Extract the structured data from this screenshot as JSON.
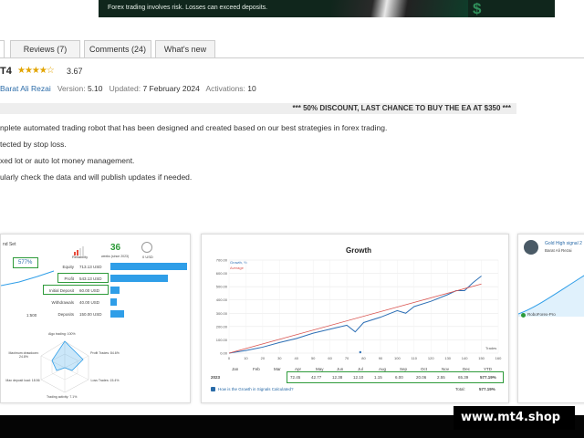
{
  "banner": {
    "text": "Forex trading involves risk. Losses can exceed deposits."
  },
  "tabs": [
    "Reviews (7)",
    "Comments (24)",
    "What's new"
  ],
  "product": {
    "title": "T4",
    "rating": "3.67",
    "rating_value": 3.67,
    "author": "Barat Ali Rezai",
    "version_label": "Version:",
    "version": "5.10",
    "updated_label": "Updated:",
    "updated": "7 February 2024",
    "activations_label": "Activations:",
    "activations": "10"
  },
  "discount": "*** 50% DISCOUNT, LAST CHANCE TO BUY THE EA AT $350 ***",
  "description": [
    "nplete automated trading robot that has been designed and created based on our best strategies in forex trading.",
    "tected by stop loss.",
    "xed lot or auto lot money management.",
    "ularly check the data and will publish updates if needed."
  ],
  "panel1": {
    "heading": "nd Set",
    "growth_badge": "577%",
    "weeks_value": "36",
    "weeks_label": "weeks (since 2023)",
    "reliability": "Reliability",
    "usd_label": "0 USD",
    "rows": [
      {
        "label": "Equity",
        "value": "713.13 USD",
        "fraction": 1.0
      },
      {
        "label": "Profit",
        "value": "543.13 USD",
        "fraction": 0.75
      },
      {
        "label": "Initial Deposit",
        "value": "60.00 USD",
        "fraction": 0.12
      },
      {
        "label": "Withdrawals",
        "value": "40.00 USD",
        "fraction": 0.08
      },
      {
        "label": "Deposits",
        "value": "150.00 USD",
        "fraction": 0.18
      }
    ],
    "leverage": "1:500",
    "radar": {
      "algo": "Algo trading: 100%",
      "max_dd": "Maximum drawdown: 24.8%",
      "profit_trades": "Profit Trades: 84.6%",
      "max_deposit_load": "Max deposit load: 18.56",
      "loss_trades": "Loss Trades: 15.4%",
      "activity": "Trading activity: 7.1%"
    }
  },
  "panel2": {
    "title": "Growth",
    "legend_growth": "Growth, %",
    "legend_average": "Average",
    "y_ticks": [
      "700.00",
      "600.00",
      "500.00",
      "400.00",
      "300.00",
      "200.00",
      "100.00",
      "0.00"
    ],
    "x_ticks": [
      "0",
      "10",
      "20",
      "30",
      "40",
      "50",
      "60",
      "70",
      "80",
      "90",
      "100",
      "110",
      "120",
      "130",
      "140",
      "150",
      "160"
    ],
    "x_axis_name": "Trades",
    "months": [
      "Jan",
      "Feb",
      "Mar",
      "Apr",
      "May",
      "Jun",
      "Jul",
      "Aug",
      "Sep",
      "Oct",
      "Nov",
      "Dec",
      "YTD"
    ],
    "year": "2023",
    "month_values": [
      "72.45",
      "42.77",
      "12.38",
      "12.10",
      "1.15",
      "6.00",
      "20.06",
      "2.55",
      "65.39",
      "577.19%"
    ],
    "question": "How is the Growth in Signals Calculated?",
    "total_label": "Total:",
    "total_value": "577.19%"
  },
  "panel3": {
    "title": "Gold High signal 2",
    "author": "Barat Ali Rezai",
    "broker": "RoboForex-Pro"
  },
  "chart_data": {
    "type": "line",
    "title": "Growth",
    "xlabel": "Trades",
    "ylabel": "",
    "xlim": [
      0,
      160
    ],
    "ylim": [
      0,
      700
    ],
    "series": [
      {
        "name": "Growth, %",
        "x": [
          0,
          10,
          20,
          30,
          40,
          50,
          60,
          70,
          75,
          80,
          90,
          100,
          105,
          110,
          120,
          130,
          135,
          140,
          145,
          148,
          150
        ],
        "values": [
          0,
          20,
          45,
          80,
          110,
          150,
          180,
          210,
          160,
          230,
          270,
          320,
          300,
          350,
          390,
          440,
          470,
          470,
          530,
          560,
          580
        ]
      },
      {
        "name": "Average",
        "x": [
          0,
          150
        ],
        "values": [
          0,
          520
        ]
      }
    ]
  },
  "watermark": "www.mt4.shop",
  "colors": {
    "highlight": "#2e9b3a",
    "bar": "#2f9ee8",
    "growth_line": "#2d6fb5",
    "average_line": "#d9534f"
  }
}
